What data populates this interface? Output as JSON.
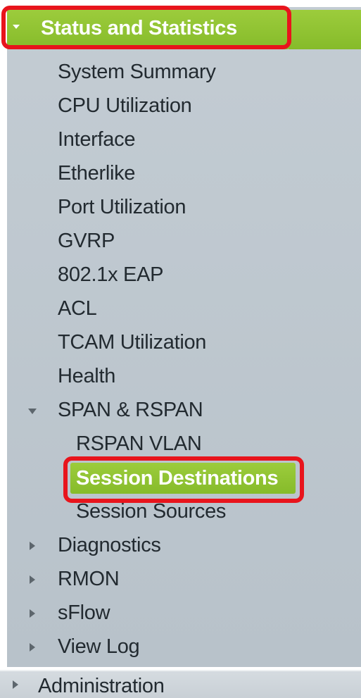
{
  "header": {
    "title": "Status and Statistics"
  },
  "menu": {
    "system_summary": "System Summary",
    "cpu_utilization": "CPU Utilization",
    "interface": "Interface",
    "etherlike": "Etherlike",
    "port_utilization": "Port Utilization",
    "gvrp": "GVRP",
    "eap": "802.1x EAP",
    "acl": "ACL",
    "tcam_utilization": "TCAM Utilization",
    "health": "Health",
    "span_rspan": "SPAN & RSPAN",
    "rspan_vlan": "RSPAN VLAN",
    "session_destinations": "Session Destinations",
    "session_sources": "Session Sources",
    "diagnostics": "Diagnostics",
    "rmon": "RMON",
    "sflow": "sFlow",
    "view_log": "View Log",
    "administration": "Administration"
  },
  "icons": {
    "expanded": "caret-down-icon",
    "collapsed": "caret-right-icon"
  },
  "colors": {
    "accent_green": "#8cc332",
    "highlight_red": "#e8141c",
    "nav_background": "#bec7ce"
  }
}
